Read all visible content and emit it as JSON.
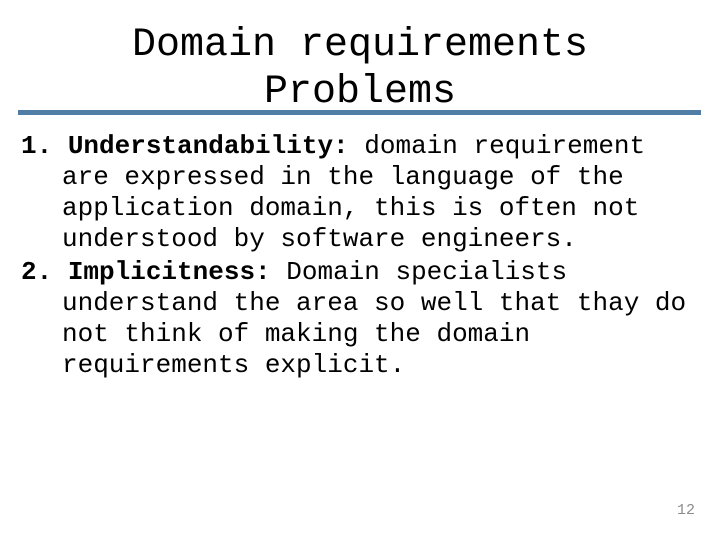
{
  "slide": {
    "background_color": "#ffffff",
    "text_color": "#000000",
    "title": {
      "line1": "Domain requirements",
      "line2": "Problems"
    },
    "divider": {
      "color": "#4f7da5"
    },
    "items": [
      {
        "marker": "1. ",
        "term": "Understandability:",
        "first_line_rest": " domain requirement",
        "continuation_lines": [
          "are expressed in the language of the",
          "application domain, this is often not",
          "understood by software engineers."
        ]
      },
      {
        "marker": "2. ",
        "term": "Implicitness:",
        "first_line_rest": " Domain specialists",
        "continuation_lines": [
          "understand the area so well that thay do",
          "not think of making the domain",
          "requirements explicit."
        ]
      }
    ],
    "page_number": "12",
    "page_number_color": "#8c8c8c"
  }
}
